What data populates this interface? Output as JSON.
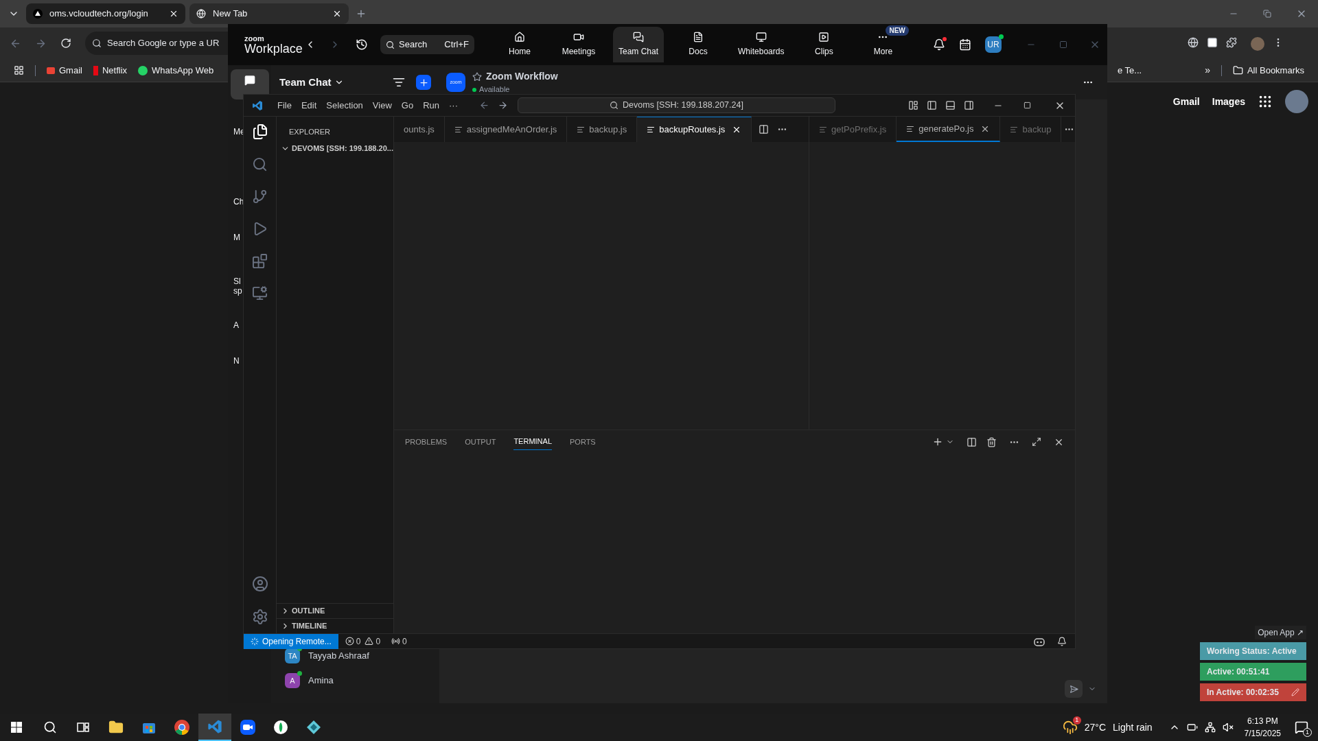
{
  "browser": {
    "tabs": [
      {
        "title": "oms.vcloudtech.org/login",
        "selected": false
      },
      {
        "title": "New Tab",
        "selected": true
      }
    ],
    "address": {
      "placeholder": "Search Google or type a UR"
    },
    "bookmarks": [
      "Gmail",
      "Netflix",
      "WhatsApp Web"
    ],
    "bookmark_fragment": "e Te...",
    "overflow": "»",
    "all_bookmarks": "All Bookmarks",
    "google_links": [
      "Gmail",
      "Images"
    ]
  },
  "zoom": {
    "logo_top": "zoom",
    "logo_bottom": "Workplace",
    "search": {
      "placeholder": "Search",
      "shortcut": "Ctrl+F"
    },
    "nav": [
      {
        "kind": "home",
        "label": "Home",
        "selected": false
      },
      {
        "kind": "meetings",
        "label": "Meetings",
        "selected": false
      },
      {
        "kind": "chat",
        "label": "Team Chat",
        "selected": true
      },
      {
        "kind": "docs",
        "label": "Docs",
        "selected": false
      },
      {
        "kind": "whiteboards",
        "label": "Whiteboards",
        "selected": false
      },
      {
        "kind": "clips",
        "label": "Clips",
        "selected": false
      },
      {
        "kind": "more",
        "label": "More",
        "selected": false,
        "badge": "NEW"
      }
    ],
    "avatar": "UR",
    "side_fragments": [
      "Me",
      "Ch",
      "M",
      "Sl",
      "sp",
      "A",
      "N"
    ],
    "chat_title": "Team Chat",
    "channel": {
      "logo": "zoom",
      "name": "Zoom Workflow",
      "status": "Available"
    },
    "contacts": [
      {
        "initials": "TA",
        "name": "Tayyab Ashraaf",
        "color": "#2d86c4"
      },
      {
        "initials": "A",
        "name": "Amina",
        "color": "#8e44ad"
      }
    ]
  },
  "vscode": {
    "menu": [
      "File",
      "Edit",
      "Selection",
      "View",
      "Go",
      "Run",
      "···"
    ],
    "command_center": "Devoms [SSH: 199.188.207.24]",
    "explorer_title": "EXPLORER",
    "folder": "DEVOMS [SSH: 199.188.20...",
    "tabs": [
      {
        "label": "ounts.js",
        "selected": false
      },
      {
        "label": "assignedMeAnOrder.js",
        "selected": false
      },
      {
        "label": "backup.js",
        "selected": false
      },
      {
        "label": "backupRoutes.js",
        "selected": true
      }
    ],
    "tabs_right": [
      {
        "label": "getPoPrefix.js",
        "selected": false
      },
      {
        "label": "generatePo.js",
        "selected": true
      },
      {
        "label": "backup",
        "selected": false
      }
    ],
    "panel_tabs": [
      {
        "label": "PROBLEMS",
        "selected": false
      },
      {
        "label": "OUTPUT",
        "selected": false
      },
      {
        "label": "TERMINAL",
        "selected": true
      },
      {
        "label": "PORTS",
        "selected": false
      }
    ],
    "sections": [
      "OUTLINE",
      "TIMELINE"
    ],
    "status": {
      "remote": "Opening Remote...",
      "errors": "0",
      "warnings": "0",
      "ports": "0"
    }
  },
  "tracker": {
    "open_app": "Open App ↗",
    "rows": [
      {
        "text": "Working Status: Active",
        "color": "#4a9aa6"
      },
      {
        "text": "Active: 00:51:41",
        "color": "#2e9e5e"
      },
      {
        "text": "In Active: 00:02:35",
        "color": "#c0433b"
      }
    ]
  },
  "taskbar": {
    "apps": [
      {
        "kind": "explorer",
        "active": false
      },
      {
        "kind": "store",
        "active": false
      },
      {
        "kind": "chrome",
        "active": false
      },
      {
        "kind": "vscode",
        "active": true
      },
      {
        "kind": "zoom",
        "active": false
      },
      {
        "kind": "green",
        "active": false
      },
      {
        "kind": "diamond",
        "active": false
      }
    ],
    "weather": {
      "badge": "1",
      "temp": "27°C",
      "desc": "Light rain"
    },
    "time": "6:13 PM",
    "date": "7/15/2025",
    "notifications": "1"
  }
}
